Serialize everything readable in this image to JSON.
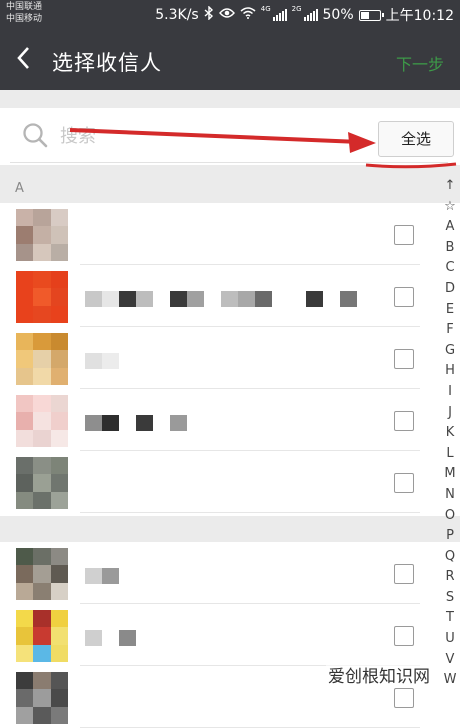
{
  "status_bar": {
    "carrier_1": "中国联通",
    "carrier_2": "中国移动",
    "net_speed": "5.3K/s",
    "net_4g": "4G",
    "net_2g": "2G",
    "battery": "50%",
    "battery_level": 0.5,
    "time": "上午10:12"
  },
  "titlebar": {
    "back_icon": "chevron-left-icon",
    "title": "选择收信人",
    "next_label": "下一步"
  },
  "search": {
    "icon": "search-icon",
    "placeholder": "搜索",
    "select_all_label": "全选"
  },
  "annotation": {
    "color": "#d42a2a"
  },
  "section": {
    "header": "A"
  },
  "contacts": [
    {
      "avatar_colors": [
        "#c9b2a8",
        "#b8a49a",
        "#d8cbc4",
        "#9c7d70",
        "#c4b0a5",
        "#cfc2b8",
        "#a6938a",
        "#d6c7bc",
        "#b9aea5"
      ],
      "name_blocks": [],
      "checked": false
    },
    {
      "avatar_colors": [
        "#e8421c",
        "#e94a1f",
        "#e5401b",
        "#e8421c",
        "#f05a2a",
        "#e4451f",
        "#e8421c",
        "#e64720",
        "#e8421c"
      ],
      "name_blocks": [
        "#c8c8c8",
        "#e6e6e6",
        "#3a3a3a",
        "#bdbdbd",
        "#ffffff",
        "#3a3a3a",
        "#a0a0a0",
        "#ffffff",
        "#bdbdbd",
        "#a8a8a8",
        "#6a6a6a",
        "#ffffff",
        "#ffffff",
        "#3a3a3a",
        "#ffffff",
        "#777777"
      ],
      "checked": false
    },
    {
      "avatar_colors": [
        "#e8b55a",
        "#d99a3a",
        "#c98a2f",
        "#f0c87a",
        "#e6d0a8",
        "#d4a86a",
        "#e6c58c",
        "#f1d9a8",
        "#e0b070"
      ],
      "name_blocks": [
        "#e0e0e0",
        "#ececec"
      ],
      "checked": false
    },
    {
      "avatar_colors": [
        "#f1c6c3",
        "#f8d8d6",
        "#ebd6d2",
        "#e8b0ad",
        "#f5e2e0",
        "#f0cfcc",
        "#f2dedc",
        "#ead3d1",
        "#f6e8e6"
      ],
      "name_blocks": [
        "#8e8e8e",
        "#2e2e2e",
        "#ffffff",
        "#3a3a3a",
        "#ffffff",
        "#9a9a9a"
      ],
      "checked": false
    },
    {
      "avatar_colors": [
        "#6a6f6a",
        "#8a8f86",
        "#7d8478",
        "#5d625d",
        "#9aa094",
        "#70766f",
        "#858b80",
        "#6b716a",
        "#9ca298"
      ],
      "name_blocks": [],
      "checked": false
    },
    {
      "avatar_colors": [
        "#4e5a4a",
        "#6b6f66",
        "#8c8a84",
        "#7a6a5c",
        "#a49e94",
        "#5f5a52",
        "#b9a996",
        "#8a7f72",
        "#d7d0c6"
      ],
      "name_blocks": [
        "#d0d0d0",
        "#9a9a9a"
      ],
      "checked": false
    },
    {
      "avatar_colors": [
        "#f3d94a",
        "#a8302a",
        "#f0d040",
        "#e8c43a",
        "#c83a30",
        "#f2e070",
        "#f5e27a",
        "#5bb8e6",
        "#f0dc64"
      ],
      "name_blocks": [
        "#cfcfcf",
        "#ffffff",
        "#8a8a8a"
      ],
      "checked": false
    },
    {
      "avatar_colors": [
        "#3c3c3c",
        "#8a7c70",
        "#555555",
        "#6a6a6a",
        "#9c9c9c",
        "#4a4a4a",
        "#a0a0a0",
        "#5a5a5a",
        "#7a7a7a"
      ],
      "name_blocks": [],
      "checked": false
    }
  ],
  "index_letters": [
    "↑",
    "☆",
    "A",
    "B",
    "C",
    "D",
    "E",
    "F",
    "G",
    "H",
    "I",
    "J",
    "K",
    "L",
    "M",
    "N",
    "O",
    "P",
    "Q",
    "R",
    "S",
    "T",
    "U",
    "V",
    "W"
  ],
  "watermark": "爱创根知识网"
}
